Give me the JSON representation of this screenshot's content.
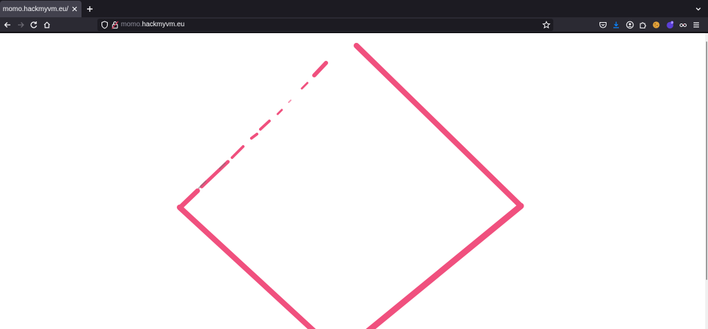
{
  "tab": {
    "title": "momo.hackmyvm.eu/"
  },
  "urlbar": {
    "subdomain": "momo.",
    "domain": "hackmyvm.eu"
  },
  "icons": {
    "tab_close": "close-icon",
    "new_tab": "plus-icon",
    "tab_list": "chevron-down-icon",
    "back": "arrow-left-icon",
    "forward": "arrow-right-icon",
    "reload": "reload-icon",
    "home": "home-icon",
    "tracking_protection": "shield-icon",
    "connection": "lock-insecure-icon",
    "bookmark": "star-icon",
    "pocket": "pocket-icon",
    "downloads": "download-icon",
    "account": "account-icon",
    "extensions": "puzzle-icon",
    "extension_a": "cookie-icon",
    "extension_b": "badge-icon",
    "extension_c": "glasses-icon",
    "menu": "hamburger-icon"
  },
  "colors": {
    "shape_stroke": "#f0507e",
    "page_background": "#ffffff",
    "toolbar_background": "#2b2a33",
    "download_accent": "#0a84ff"
  }
}
